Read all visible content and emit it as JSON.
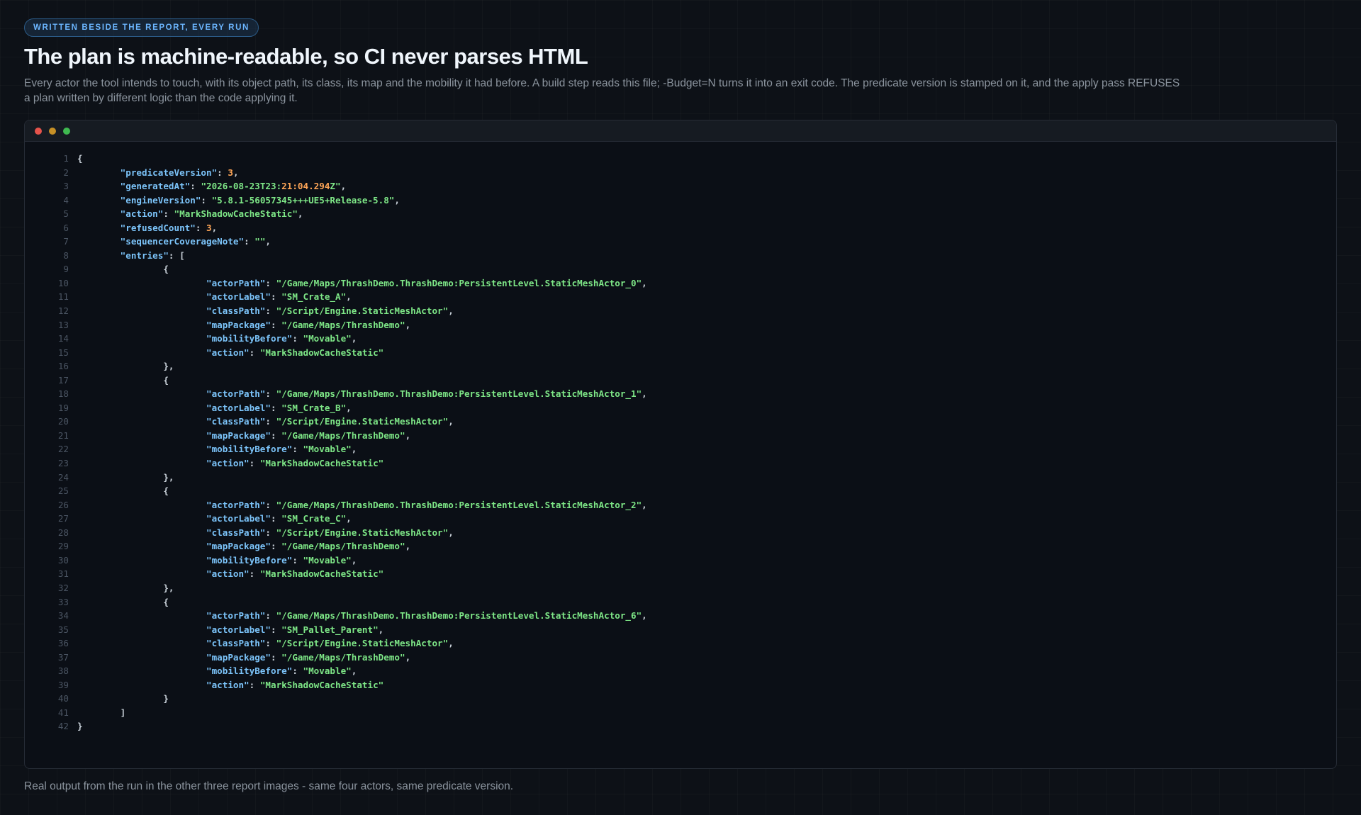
{
  "header": {
    "badge": "WRITTEN BESIDE THE REPORT, EVERY RUN",
    "title": "The plan is machine-readable, so CI never parses HTML",
    "description": "Every actor the tool intends to touch, with its object path, its class, its map and the mobility it had before. A build step reads this file; -Budget=N turns it into an exit code. The predicate version is stamped on it, and the apply pass REFUSES a plan written by different logic than the code applying it."
  },
  "window": {
    "controls": [
      "close-dot",
      "minimize-dot",
      "maximize-dot"
    ],
    "colors": {
      "close": "#e5534b",
      "minimize": "#c69026",
      "maximize": "#3fb950"
    }
  },
  "code": {
    "line_numbers": [
      "1",
      "2",
      "3",
      "4",
      "5",
      "6",
      "7",
      "8",
      "9",
      "10",
      "11",
      "12",
      "13",
      "14",
      "15",
      "16",
      "17",
      "18",
      "19",
      "20",
      "21",
      "22",
      "23",
      "24",
      "25",
      "26",
      "27",
      "28",
      "29",
      "30",
      "31",
      "32",
      "33",
      "34",
      "35",
      "36",
      "37",
      "38",
      "39",
      "40",
      "41",
      "42"
    ],
    "lines": [
      "{",
      "\t\"predicateVersion\": 3,",
      "\t\"generatedAt\": \"2026-08-23T23:21:04.294Z\",",
      "\t\"engineVersion\": \"5.8.1-56057345+++UE5+Release-5.8\",",
      "\t\"action\": \"MarkShadowCacheStatic\",",
      "\t\"refusedCount\": 3,",
      "\t\"sequencerCoverageNote\": \"\",",
      "\t\"entries\": [",
      "\t\t{",
      "\t\t\t\"actorPath\": \"/Game/Maps/ThrashDemo.ThrashDemo:PersistentLevel.StaticMeshActor_0\",",
      "\t\t\t\"actorLabel\": \"SM_Crate_A\",",
      "\t\t\t\"classPath\": \"/Script/Engine.StaticMeshActor\",",
      "\t\t\t\"mapPackage\": \"/Game/Maps/ThrashDemo\",",
      "\t\t\t\"mobilityBefore\": \"Movable\",",
      "\t\t\t\"action\": \"MarkShadowCacheStatic\"",
      "\t\t},",
      "\t\t{",
      "\t\t\t\"actorPath\": \"/Game/Maps/ThrashDemo.ThrashDemo:PersistentLevel.StaticMeshActor_1\",",
      "\t\t\t\"actorLabel\": \"SM_Crate_B\",",
      "\t\t\t\"classPath\": \"/Script/Engine.StaticMeshActor\",",
      "\t\t\t\"mapPackage\": \"/Game/Maps/ThrashDemo\",",
      "\t\t\t\"mobilityBefore\": \"Movable\",",
      "\t\t\t\"action\": \"MarkShadowCacheStatic\"",
      "\t\t},",
      "\t\t{",
      "\t\t\t\"actorPath\": \"/Game/Maps/ThrashDemo.ThrashDemo:PersistentLevel.StaticMeshActor_2\",",
      "\t\t\t\"actorLabel\": \"SM_Crate_C\",",
      "\t\t\t\"classPath\": \"/Script/Engine.StaticMeshActor\",",
      "\t\t\t\"mapPackage\": \"/Game/Maps/ThrashDemo\",",
      "\t\t\t\"mobilityBefore\": \"Movable\",",
      "\t\t\t\"action\": \"MarkShadowCacheStatic\"",
      "\t\t},",
      "\t\t{",
      "\t\t\t\"actorPath\": \"/Game/Maps/ThrashDemo.ThrashDemo:PersistentLevel.StaticMeshActor_6\",",
      "\t\t\t\"actorLabel\": \"SM_Pallet_Parent\",",
      "\t\t\t\"classPath\": \"/Script/Engine.StaticMeshActor\",",
      "\t\t\t\"mapPackage\": \"/Game/Maps/ThrashDemo\",",
      "\t\t\t\"mobilityBefore\": \"Movable\",",
      "\t\t\t\"action\": \"MarkShadowCacheStatic\"",
      "\t\t}",
      "\t]",
      "}"
    ]
  },
  "footer": {
    "caption": "Real output from the run in the other three report images - same four actors, same predicate version."
  }
}
